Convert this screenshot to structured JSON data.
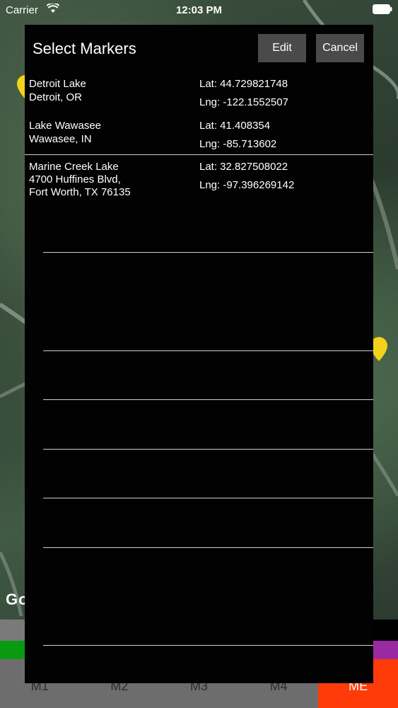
{
  "status_bar": {
    "carrier": "Carrier",
    "time": "12:03 PM"
  },
  "map": {
    "attribution": "Go"
  },
  "modal": {
    "title": "Select Markers",
    "edit_label": "Edit",
    "cancel_label": "Cancel",
    "markers": [
      {
        "name": "Detroit Lake",
        "address_lines": [
          "Detroit, OR"
        ],
        "lat": "Lat: 44.729821748",
        "lng": "Lng: -122.1552507"
      },
      {
        "name": "Lake Wawasee",
        "address_lines": [
          "Wawasee, IN"
        ],
        "lat": "Lat: 41.408354",
        "lng": "Lng: -85.713602"
      },
      {
        "name": "Marine Creek Lake",
        "address_lines": [
          "4700 Huffines Blvd,",
          "Fort Worth, TX 76135"
        ],
        "lat": "Lat: 32.827508022",
        "lng": "Lng: -97.396269142"
      }
    ]
  },
  "tabs": [
    {
      "label": "M1",
      "active": false
    },
    {
      "label": "M2",
      "active": false
    },
    {
      "label": "M3",
      "active": false
    },
    {
      "label": "M4",
      "active": false
    },
    {
      "label": "ME",
      "active": true
    }
  ],
  "colors": {
    "active_tab": "#ff3b0a",
    "strip_green": "#0a9a12",
    "strip_purple": "#9a2aa0",
    "modal_bg": "#020202",
    "button_bg": "#4a4a4a"
  }
}
